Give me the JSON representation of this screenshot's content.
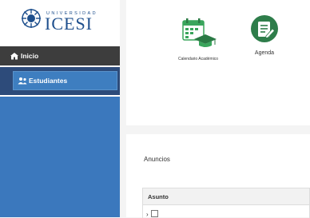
{
  "logo": {
    "university": "UNIVERSIDAD",
    "name": "ICESI"
  },
  "sidebar": {
    "items": [
      {
        "label": "Inicio",
        "icon": "home-icon"
      },
      {
        "label": "Estudiantes",
        "icon": "students-icon"
      }
    ]
  },
  "tiles": [
    {
      "label": "Calendario Académico",
      "icon": "calendar-graduation-icon"
    },
    {
      "label": "Agenda",
      "icon": "agenda-icon"
    }
  ],
  "anuncios": {
    "title": "Anuncios",
    "table": {
      "header": "Asunto"
    }
  },
  "colors": {
    "sidebar_blue": "#3b78bd",
    "active_item": "#3e7ec0",
    "dark_item": "#3d3d3d",
    "brand": "#1e4f8d",
    "agenda_green": "#2e7d4a",
    "calendar_green": "#3aa55c"
  }
}
